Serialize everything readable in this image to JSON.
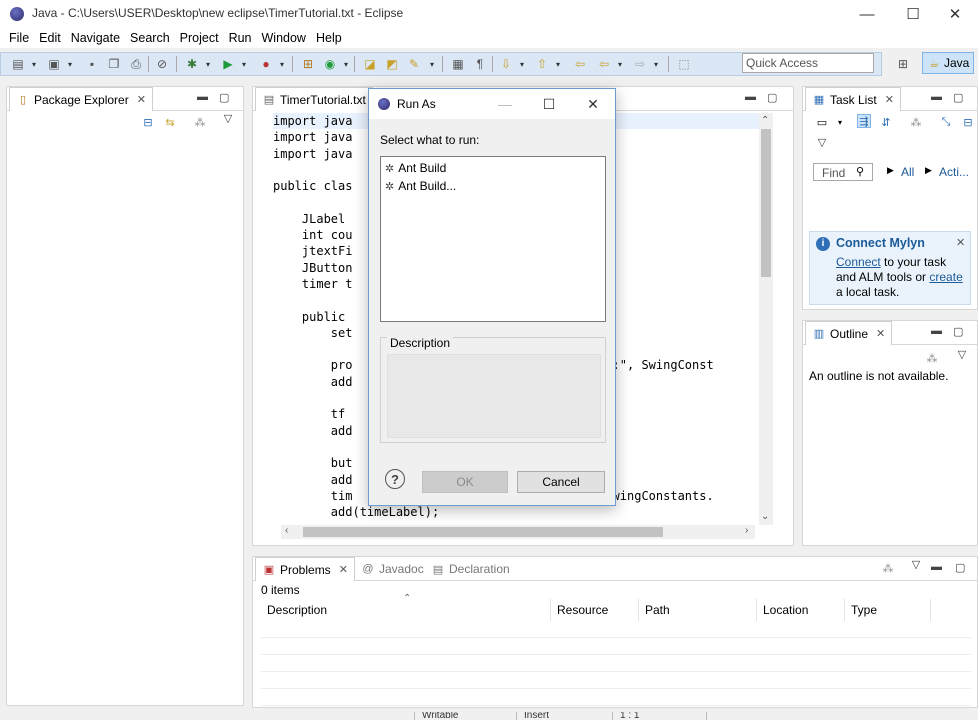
{
  "window": {
    "title": "Java - C:\\Users\\USER\\Desktop\\new eclipse\\TimerTutorial.txt - Eclipse",
    "minimize": "—",
    "maximize": "☐",
    "close": "✕"
  },
  "menu": [
    "File",
    "Edit",
    "Navigate",
    "Search",
    "Project",
    "Run",
    "Window",
    "Help"
  ],
  "toolbar": {
    "quick_access_placeholder": "Quick Access",
    "perspective": "Java"
  },
  "package_explorer": {
    "title": "Package Explorer"
  },
  "editor": {
    "tab": "TimerTutorial.txt",
    "lines": [
      "import java",
      "import java",
      "import java",
      "",
      "public clas",
      "",
      "    JLabel",
      "    int cou",
      "    jtextFi",
      "    JButton",
      "    timer t",
      "",
      "    public",
      "        set",
      "",
      "        pro                                onds:\", SwingConst",
      "        add",
      "",
      "        tf",
      "        add",
      "",
      "        but                                 );",
      "        add",
      "        tim                                \", SwingConstants.",
      "        add(timeLabel);"
    ]
  },
  "task_list": {
    "title": "Task List",
    "find_placeholder": "Find",
    "all": "All",
    "activate": "Acti...",
    "mylyn": {
      "title": "Connect Mylyn",
      "connect_link": "Connect",
      "text1": " to your task and ALM tools or ",
      "create_link": "create",
      "text2": " a local task."
    }
  },
  "outline": {
    "title": "Outline",
    "message": "An outline is not available."
  },
  "problems": {
    "tabs": [
      "Problems",
      "Javadoc",
      "Declaration"
    ],
    "count": "0 items",
    "columns": [
      "Description",
      "Resource",
      "Path",
      "Location",
      "Type"
    ]
  },
  "dialog": {
    "title": "Run As",
    "prompt": "Select what to run:",
    "items": [
      "Ant Build",
      "Ant Build..."
    ],
    "description_label": "Description",
    "ok": "OK",
    "cancel": "Cancel",
    "help": "?"
  },
  "status": {
    "writable": "Writable",
    "insert": "Insert",
    "position": "1 : 1"
  },
  "colors": {
    "accent": "#1c5a99",
    "toolbar_bg": "#dbe7f4",
    "selection": "#cde3f7"
  }
}
